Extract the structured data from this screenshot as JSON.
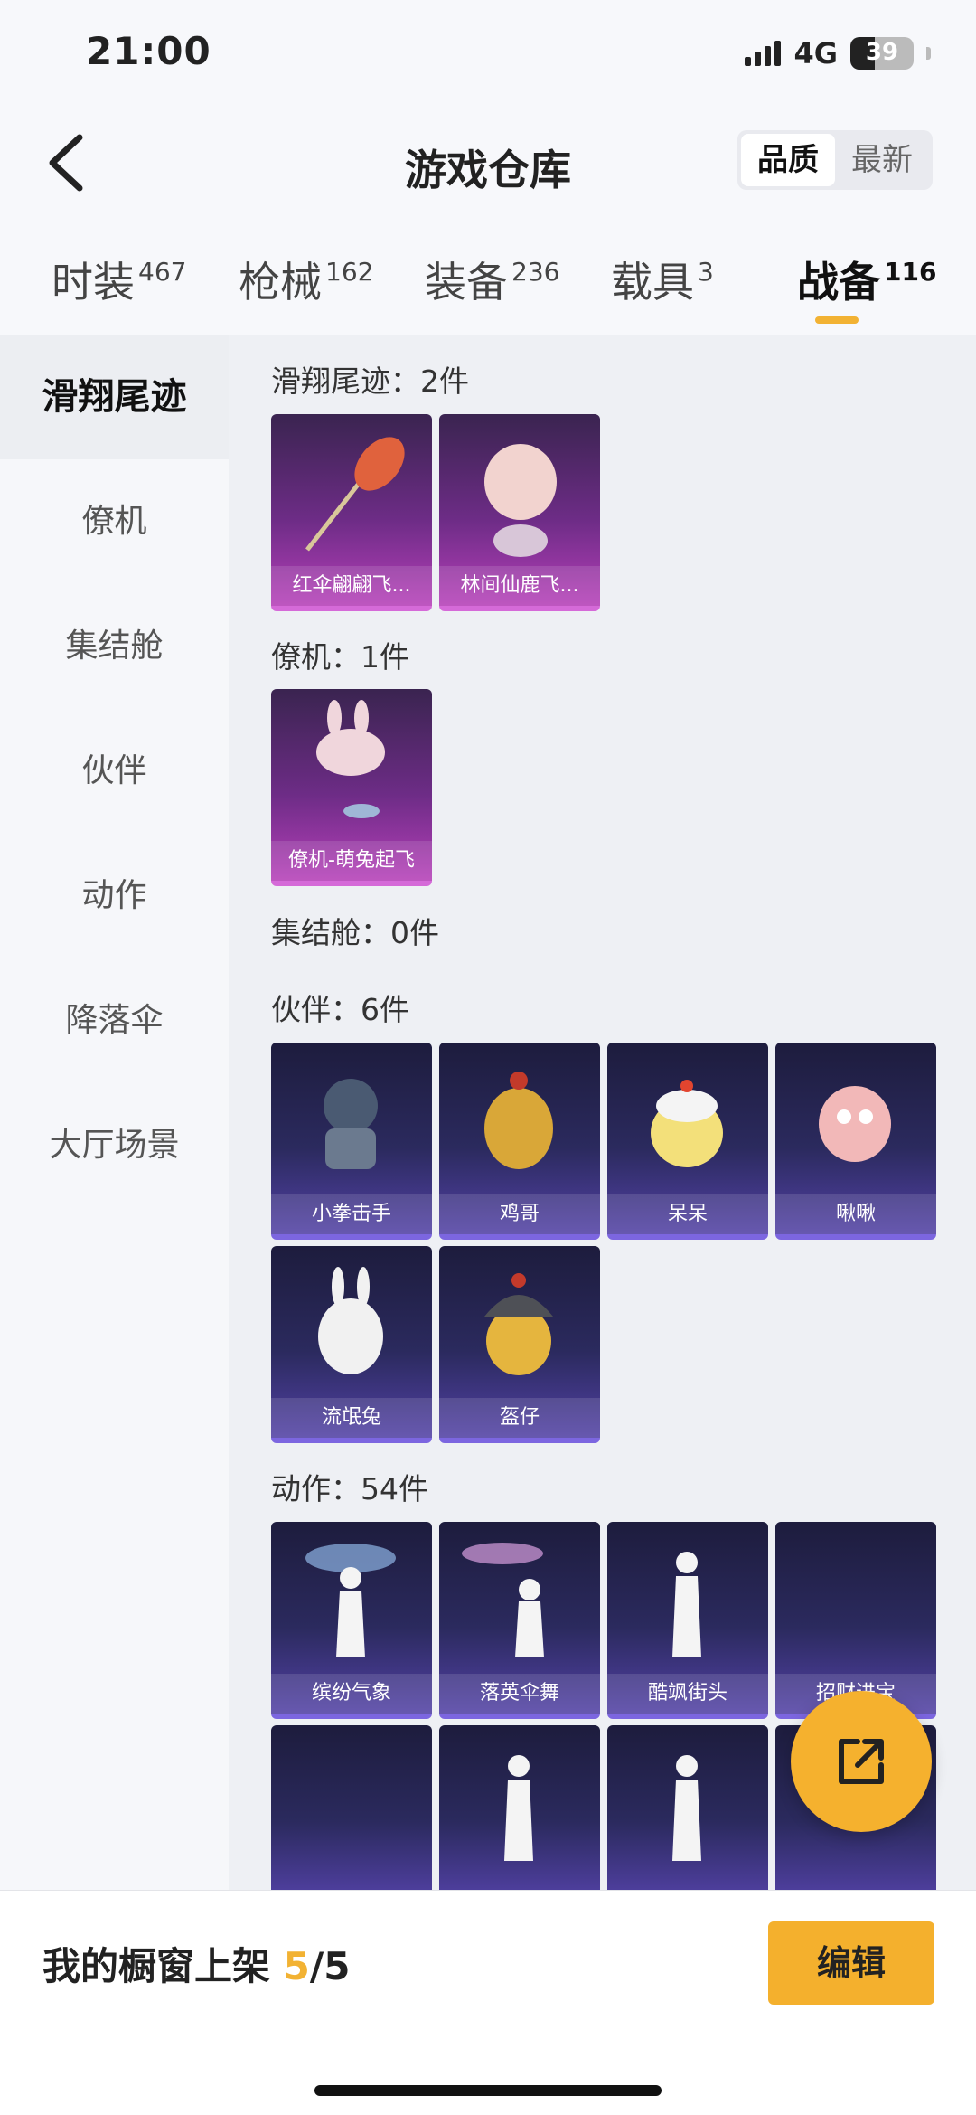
{
  "status": {
    "time": "21:00",
    "network": "4G",
    "battery": "39"
  },
  "header": {
    "title": "游戏仓库",
    "sort_quality": "品质",
    "sort_latest": "最新"
  },
  "tabs": [
    {
      "label": "时装",
      "count": "467"
    },
    {
      "label": "枪械",
      "count": "162"
    },
    {
      "label": "装备",
      "count": "236"
    },
    {
      "label": "载具",
      "count": "3"
    },
    {
      "label": "战备",
      "count": "116"
    }
  ],
  "sidebar": [
    "滑翔尾迹",
    "僚机",
    "集结舱",
    "伙伴",
    "动作",
    "降落伞",
    "大厅场景"
  ],
  "sections": {
    "glide": {
      "title": "滑翔尾迹：2件",
      "items": [
        "红伞翩翩飞...",
        "林间仙鹿飞..."
      ]
    },
    "wingman": {
      "title": "僚机：1件",
      "items": [
        "僚机-萌兔起飞"
      ]
    },
    "pod": {
      "title": "集结舱：0件"
    },
    "partner": {
      "title": "伙伴：6件",
      "items": [
        "小拳击手",
        "鸡哥",
        "呆呆",
        "啾啾",
        "流氓兔",
        "盔仔"
      ]
    },
    "emote": {
      "title": "动作：54件",
      "items": [
        "缤纷气象",
        "落英伞舞",
        "酷飒街头",
        "招财进宝"
      ]
    }
  },
  "bottom": {
    "label": "我的橱窗上架",
    "current": "5",
    "total": "/5",
    "edit": "编辑"
  }
}
